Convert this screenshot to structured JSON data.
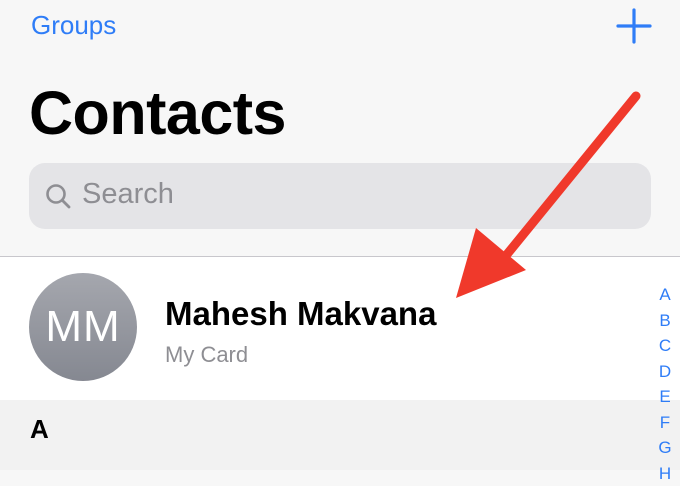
{
  "header": {
    "groups_label": "Groups",
    "add_icon": "plus-icon",
    "title": "Contacts"
  },
  "search": {
    "placeholder": "Search",
    "icon": "magnifier-icon"
  },
  "my_card": {
    "initials": "MM",
    "name": "Mahesh Makvana",
    "subtitle": "My Card"
  },
  "section": {
    "header": "A"
  },
  "index": [
    "A",
    "B",
    "C",
    "D",
    "E",
    "F",
    "G",
    "H"
  ],
  "annotation": {
    "arrow_color": "#f0392b"
  },
  "colors": {
    "accent": "#2f7df7",
    "background": "#f7f7f7"
  }
}
